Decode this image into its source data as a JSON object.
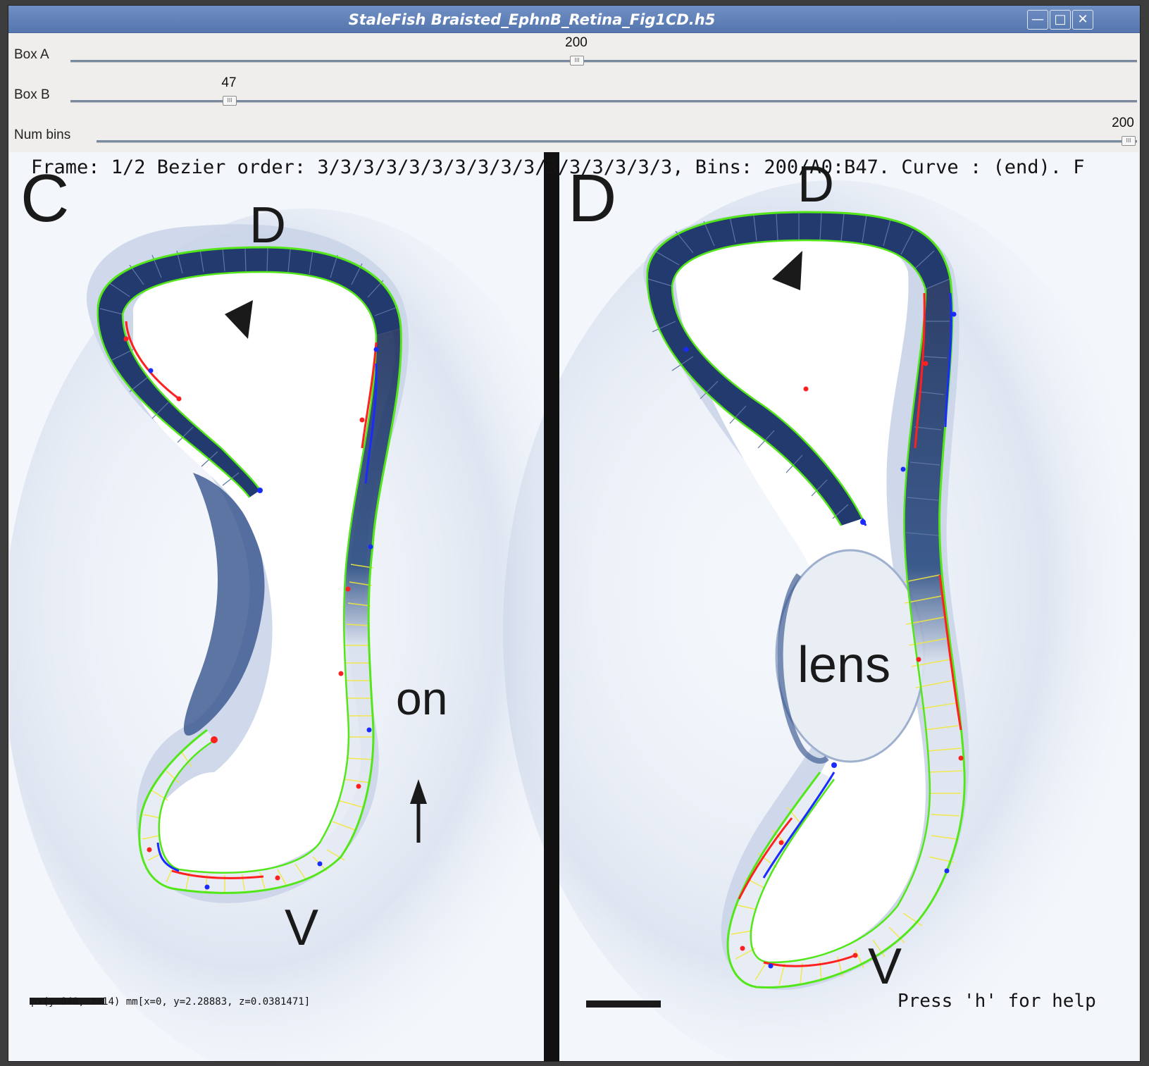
{
  "window": {
    "title": "StaleFish Braisted_EphnB_Retina_Fig1CD.h5",
    "buttons": [
      "minimize",
      "maximize",
      "close"
    ]
  },
  "sliders": [
    {
      "label": "Box A",
      "value": "200",
      "fraction": 0.5
    },
    {
      "label": "Box B",
      "value": "47",
      "fraction": 0.16
    },
    {
      "label": "Num bins",
      "value": "200",
      "fraction": 1.0
    }
  ],
  "viewer": {
    "status_line": "Frame: 1/2 Bezier order: 3/3/3/3/3/3/3/3/3/3/3/3/3/3/3/3, Bins: 200/A0:B47. Curve : (end). F",
    "panel_c": {
      "letter": "C",
      "dorsal": "D",
      "ventral": "V",
      "optic_nerve": "on"
    },
    "panel_d": {
      "letter": "D",
      "dorsal": "D",
      "ventral": "V",
      "lens": "lens"
    },
    "coords": "px(y=840, z=14) mm[x=0, y=2.28883, z=0.0381471]",
    "help": "Press 'h' for help"
  },
  "colors": {
    "stain": "#1f3f7a",
    "spline_green": "#53e619",
    "curve_red": "#ff2020",
    "curve_blue": "#1a2bff",
    "bin_yellow": "#f2e83c",
    "titlebar": "#5f7fb8"
  }
}
